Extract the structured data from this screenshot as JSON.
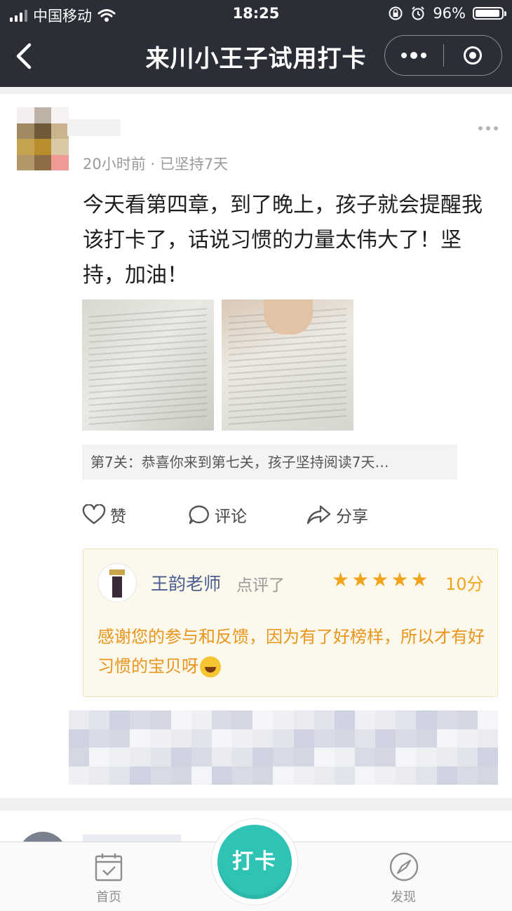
{
  "status_bar": {
    "carrier": "中国移动",
    "time": "18:25",
    "battery": "96%"
  },
  "nav": {
    "title": "来川小王子试用打卡"
  },
  "post": {
    "meta": "20小时前 · 已坚持7天",
    "content": "今天看第四章，到了晚上，孩子就会提醒我该打卡了，话说习惯的力量太伟大了！坚持，加油！",
    "level_text": "第7关：恭喜你来到第七关，孩子坚持阅读7天…",
    "actions": {
      "like": "赞",
      "comment": "评论",
      "share": "分享"
    }
  },
  "review": {
    "teacher": "王韵老师",
    "verb": "点评了",
    "stars": 5,
    "score": "10分",
    "text": "感谢您的参与和反馈，因为有了好榜样，所以才有好习惯的宝贝呀"
  },
  "tabbar": {
    "home": "首页",
    "checkin": "打卡",
    "discover": "发现"
  },
  "colors": {
    "nav_bg": "#2b2e36",
    "accent_teal": "#2fc3b6",
    "review_text": "#e8951d",
    "star": "#f1a41b",
    "teacher_name": "#4a5d8f"
  }
}
